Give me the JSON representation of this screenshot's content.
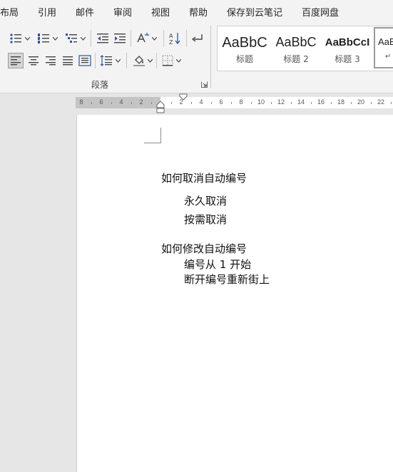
{
  "menu": {
    "tabs": [
      "布局",
      "引用",
      "邮件",
      "审阅",
      "视图",
      "帮助",
      "保存到云笔记",
      "百度网盘"
    ]
  },
  "ribbon": {
    "paragraph_group_label": "段落",
    "styles": [
      {
        "sample": "AaBbC",
        "name": "标题"
      },
      {
        "sample": "AaBbC",
        "name": "标题 2"
      },
      {
        "sample": "AaBbCcI",
        "name": "标题 3"
      },
      {
        "sample": "AaB",
        "name": "↵"
      }
    ]
  },
  "ruler": {
    "left_numbers": [
      "8",
      "6",
      "4",
      "2"
    ],
    "right_numbers": [
      "2",
      "4",
      "6",
      "8",
      "10",
      "12",
      "14",
      "16",
      "18",
      "20",
      "22"
    ]
  },
  "document": {
    "lines": [
      "如何取消自动编号",
      "永久取消",
      "按需取消",
      "如何修改自动编号",
      "编号从 1 开始",
      "断开编号重新街上"
    ]
  },
  "colors": {
    "ribbon_bg": "#f3f3f3",
    "canvas_bg": "#e6e6e6",
    "page_bg": "#ffffff",
    "icon_blue": "#2b579a"
  }
}
